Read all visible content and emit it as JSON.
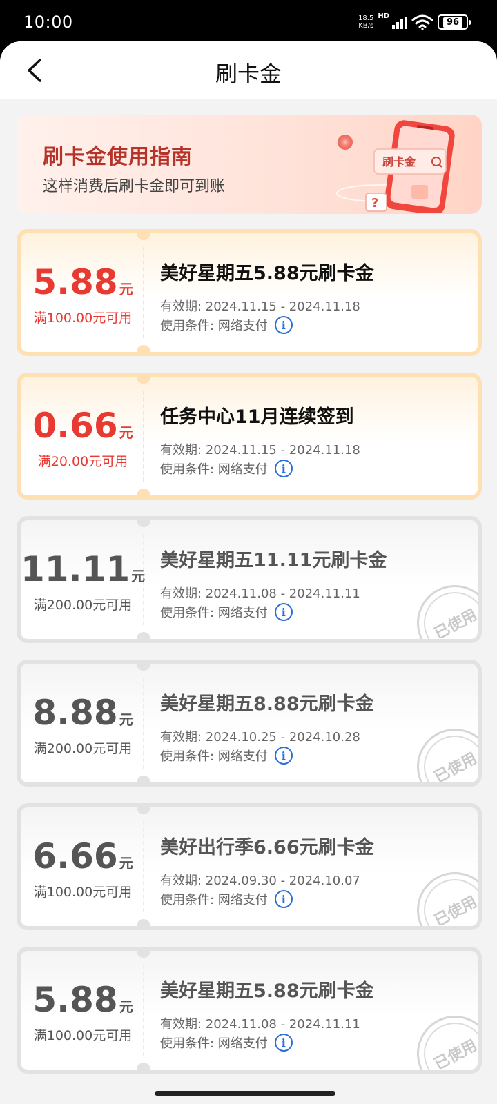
{
  "status_bar": {
    "time": "10:00",
    "speed_value": "18.5",
    "speed_unit": "KB/s",
    "network_type": "HD",
    "battery": "96",
    "icons": [
      "signal-icon",
      "wifi-icon",
      "battery-icon"
    ]
  },
  "header": {
    "title": "刷卡金",
    "back_icon": "chevron-left-icon"
  },
  "banner": {
    "title": "刷卡金使用指南",
    "subtitle": "这样消费后刷卡金即可到账",
    "illustration_label": "刷卡金"
  },
  "colors": {
    "active_accent": "#e83a33",
    "active_border": "#ffe0b2",
    "used_border": "#e2e2e2",
    "info_blue": "#2d6fd6"
  },
  "coupons": [
    {
      "amount": "5.88",
      "unit": "元",
      "condition": "满100.00元可用",
      "title": "美好星期五5.88元刷卡金",
      "validity": "有效期: 2024.11.15 - 2024.11.18",
      "usage": "使用条件: 网络支付",
      "status": "active"
    },
    {
      "amount": "0.66",
      "unit": "元",
      "condition": "满20.00元可用",
      "title": "任务中心11月连续签到",
      "validity": "有效期: 2024.11.15 - 2024.11.18",
      "usage": "使用条件: 网络支付",
      "status": "active"
    },
    {
      "amount": "11.11",
      "unit": "元",
      "condition": "满200.00元可用",
      "title": "美好星期五11.11元刷卡金",
      "validity": "有效期: 2024.11.08 - 2024.11.11",
      "usage": "使用条件: 网络支付",
      "status": "used",
      "stamp": "已使用"
    },
    {
      "amount": "8.88",
      "unit": "元",
      "condition": "满200.00元可用",
      "title": "美好星期五8.88元刷卡金",
      "validity": "有效期: 2024.10.25 - 2024.10.28",
      "usage": "使用条件: 网络支付",
      "status": "used",
      "stamp": "已使用"
    },
    {
      "amount": "6.66",
      "unit": "元",
      "condition": "满100.00元可用",
      "title": "美好出行季6.66元刷卡金",
      "validity": "有效期: 2024.09.30 - 2024.10.07",
      "usage": "使用条件: 网络支付",
      "status": "used",
      "stamp": "已使用"
    },
    {
      "amount": "5.88",
      "unit": "元",
      "condition": "满100.00元可用",
      "title": "美好星期五5.88元刷卡金",
      "validity": "有效期: 2024.11.08 - 2024.11.11",
      "usage": "使用条件: 网络支付",
      "status": "used",
      "stamp": "已使用"
    }
  ]
}
